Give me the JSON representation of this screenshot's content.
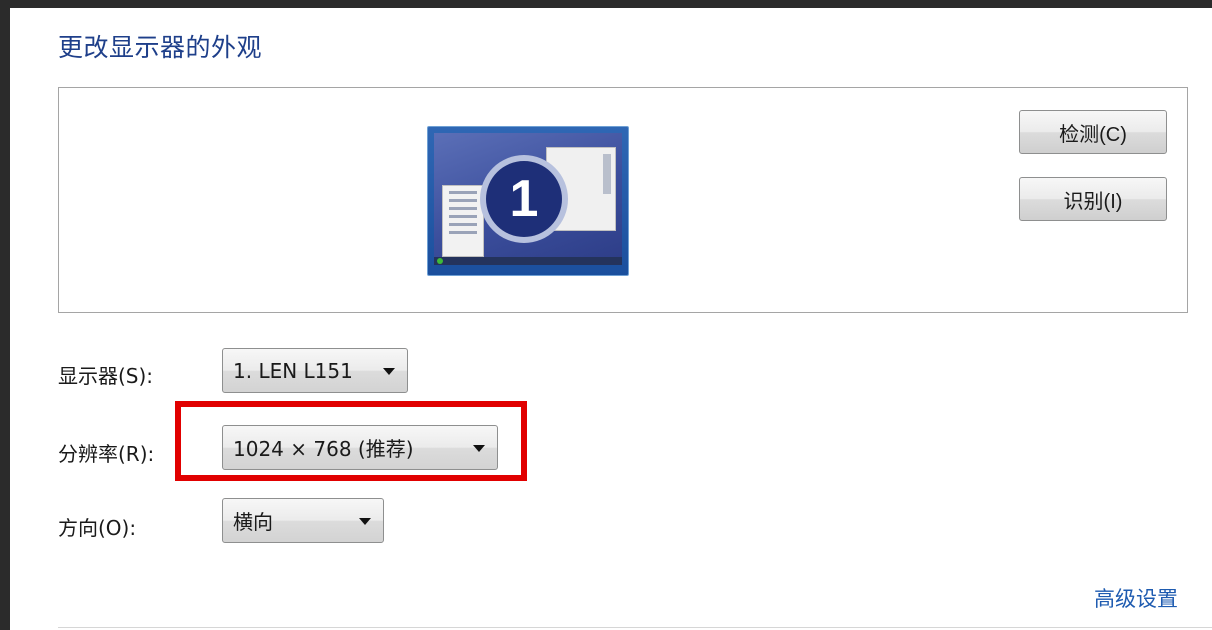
{
  "title": "更改显示器的外观",
  "preview": {
    "monitor_number": "1"
  },
  "buttons": {
    "detect": "检测(C)",
    "identify": "识别(I)"
  },
  "display": {
    "label": "显示器(S):",
    "value": "1. LEN L151"
  },
  "resolution": {
    "label": "分辨率(R):",
    "value": "1024 × 768 (推荐)"
  },
  "orientation": {
    "label": "方向(O):",
    "value": "横向"
  },
  "advanced_link": "高级设置",
  "colors": {
    "title": "#1e3f8a",
    "link": "#1e5bb0",
    "highlight": "#e10000"
  }
}
